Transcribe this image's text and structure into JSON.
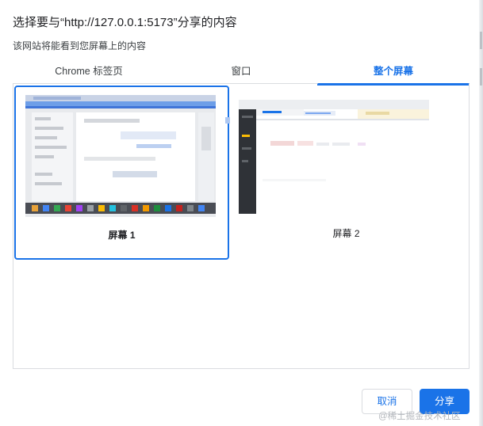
{
  "dialog": {
    "title": "选择要与“http://127.0.0.1:5173”分享的内容",
    "subtitle": "该网站将能看到您屏幕上的内容"
  },
  "tabs": [
    {
      "label": "Chrome 标签页",
      "active": false
    },
    {
      "label": "窗口",
      "active": false
    },
    {
      "label": "整个屏幕",
      "active": true
    }
  ],
  "screens": [
    {
      "label": "屏幕 1",
      "selected": true
    },
    {
      "label": "屏幕 2",
      "selected": false
    }
  ],
  "buttons": {
    "cancel": "取消",
    "share": "分享"
  },
  "watermark": "@稀土掘金技术社区",
  "colors": {
    "accent": "#1a73e8",
    "border": "#dadce0",
    "text": "#202124"
  }
}
